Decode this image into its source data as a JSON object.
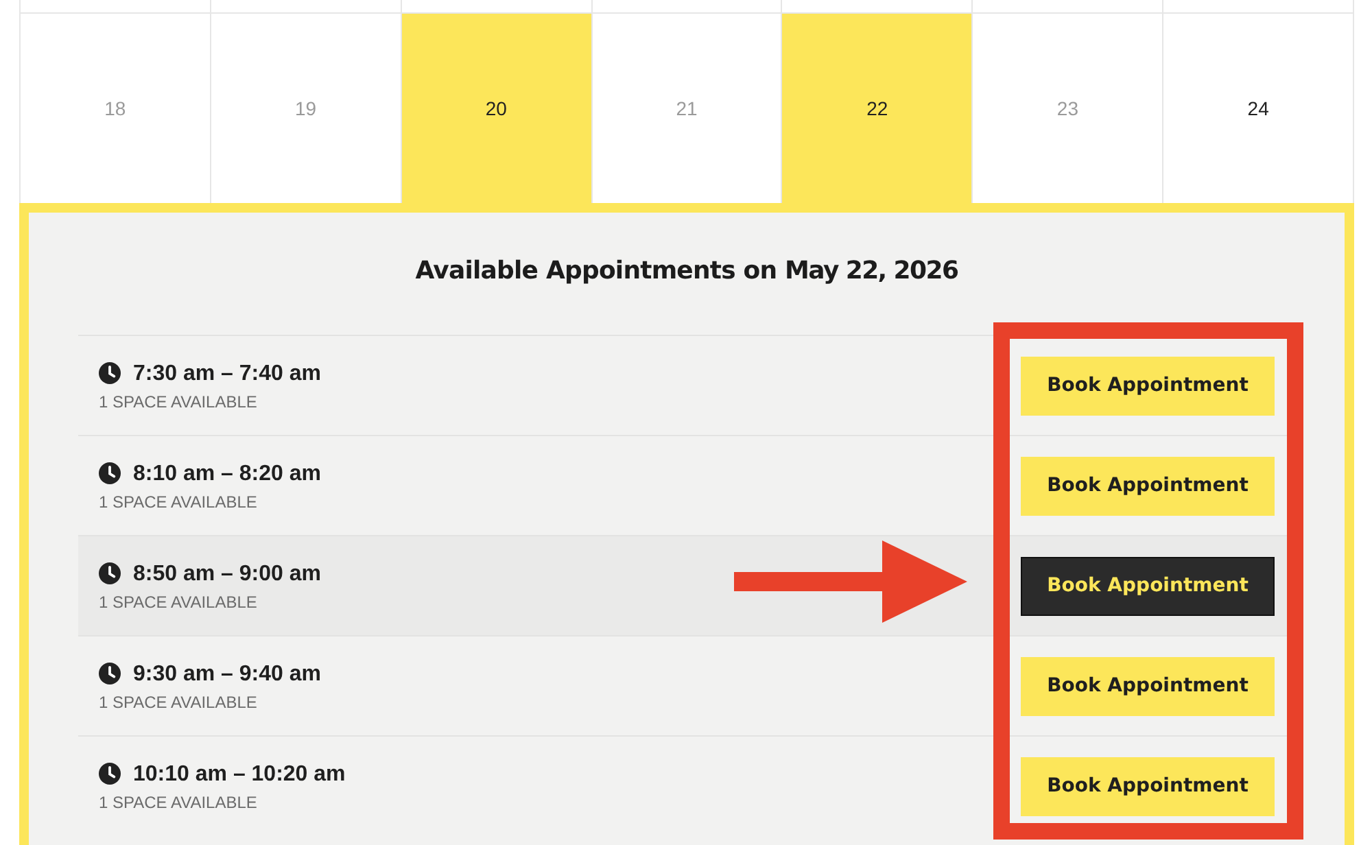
{
  "calendar": {
    "days": [
      {
        "label": "18",
        "available": false,
        "highlighted": false
      },
      {
        "label": "19",
        "available": false,
        "highlighted": false
      },
      {
        "label": "20",
        "available": true,
        "highlighted": true
      },
      {
        "label": "21",
        "available": false,
        "highlighted": false
      },
      {
        "label": "22",
        "available": true,
        "highlighted": true
      },
      {
        "label": "23",
        "available": false,
        "highlighted": false
      },
      {
        "label": "24",
        "available": true,
        "highlighted": false
      }
    ]
  },
  "appointments": {
    "title": "Available Appointments on **May 22, 2026**",
    "slots": [
      {
        "time": "7:30 am – 7:40 am",
        "spaces": "1 SPACE AVAILABLE",
        "button": "Book Appointment",
        "hovered": false
      },
      {
        "time": "8:10 am – 8:20 am",
        "spaces": "1 SPACE AVAILABLE",
        "button": "Book Appointment",
        "hovered": false
      },
      {
        "time": "8:50 am – 9:00 am",
        "spaces": "1 SPACE AVAILABLE",
        "button": "Book Appointment",
        "hovered": true
      },
      {
        "time": "9:30 am – 9:40 am",
        "spaces": "1 SPACE AVAILABLE",
        "button": "Book Appointment",
        "hovered": false
      },
      {
        "time": "10:10 am – 10:20 am",
        "spaces": "1 SPACE AVAILABLE",
        "button": "Book Appointment",
        "hovered": false
      }
    ]
  }
}
